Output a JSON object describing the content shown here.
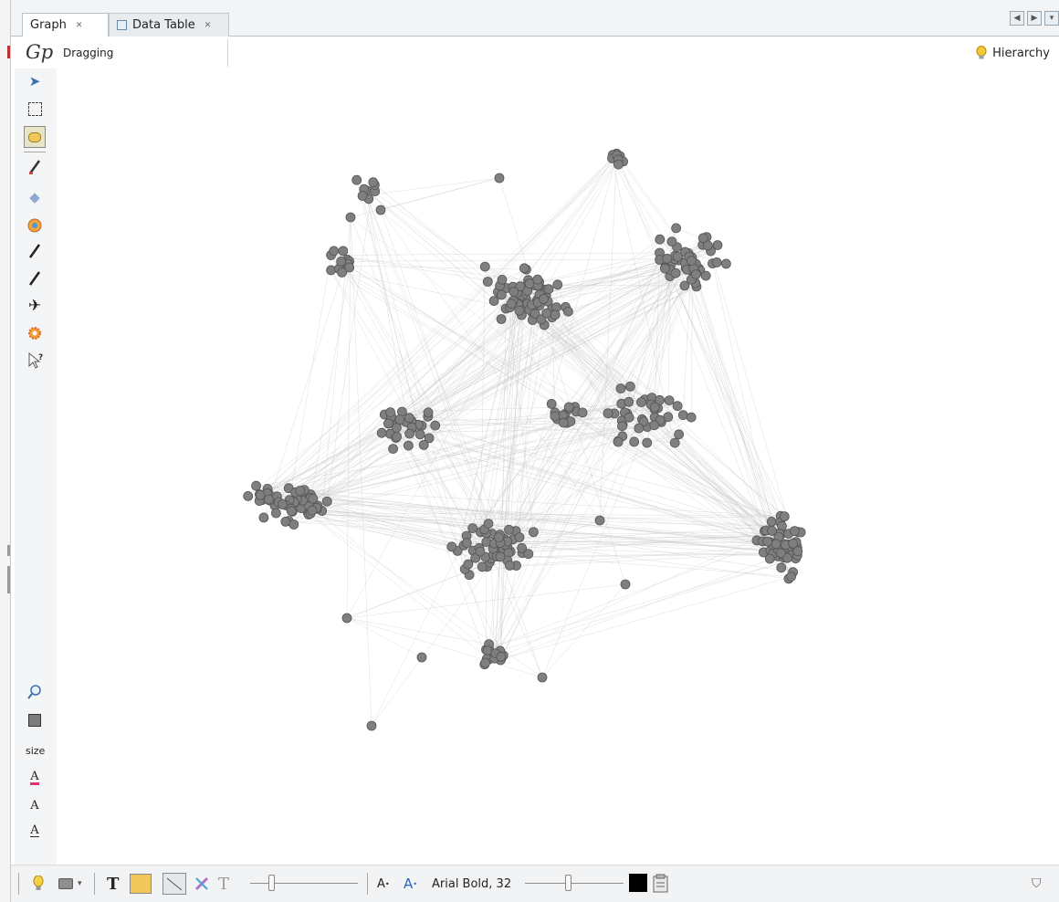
{
  "tabs": [
    {
      "label": "Graph",
      "active": true
    },
    {
      "label": "Data Table",
      "active": false
    }
  ],
  "context_bar": {
    "logo": "Gp",
    "mode": "Dragging",
    "hierarchy_label": "Hierarchy"
  },
  "left_toolbar": {
    "tools": [
      "arrow-select",
      "rectangle-select",
      "drag",
      "paintbrush",
      "diamond",
      "color-wheel",
      "pencil-1",
      "pencil-2",
      "airplane",
      "sun",
      "help-pointer"
    ],
    "selected_tool": "drag",
    "size_label": "size"
  },
  "bottom_toolbar": {
    "font_label": "Arial Bold, 32",
    "font_size_down": "A",
    "font_size_up": "A",
    "text_color": "#000000"
  },
  "graph": {
    "node_color": "#7f7f7f",
    "node_stroke": "#555555",
    "edge_color": "#c3c3c3",
    "background": "#ffffff"
  }
}
